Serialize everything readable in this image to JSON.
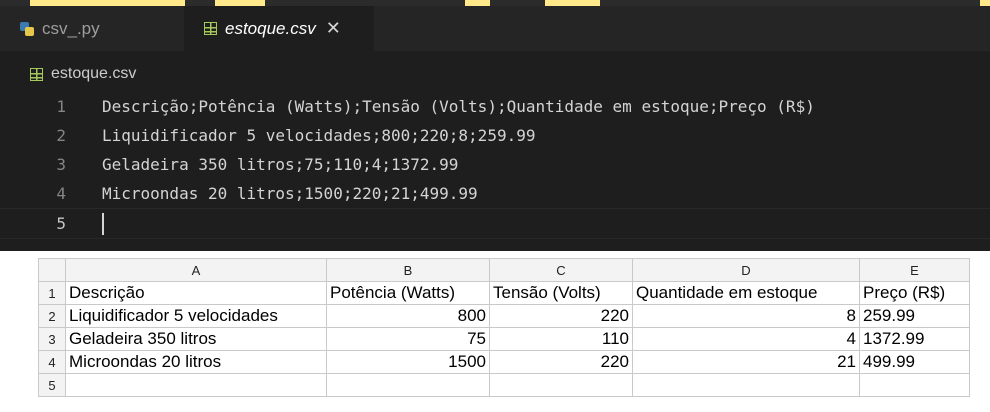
{
  "editor": {
    "tabs": [
      {
        "label": "csv_.py",
        "icon": "python-icon",
        "active": false
      },
      {
        "label": "estoque.csv",
        "icon": "csv-icon",
        "active": true,
        "close": "✕"
      }
    ],
    "breadcrumb": "estoque.csv",
    "lines": [
      {
        "num": "1",
        "text": "Descrição;Potência (Watts);Tensão (Volts);Quantidade em estoque;Preço (R$)"
      },
      {
        "num": "2",
        "text": "Liquidificador 5 velocidades;800;220;8;259.99"
      },
      {
        "num": "3",
        "text": "Geladeira 350 litros;75;110;4;1372.99"
      },
      {
        "num": "4",
        "text": "Microondas 20 litros;1500;220;21;499.99"
      },
      {
        "num": "5",
        "text": ""
      }
    ]
  },
  "spreadsheet": {
    "columns": [
      "A",
      "B",
      "C",
      "D",
      "E"
    ],
    "rows": [
      {
        "num": "1",
        "cells": [
          "Descrição",
          "Potência (Watts)",
          "Tensão (Volts)",
          "Quantidade em estoque",
          "Preço (R$)"
        ]
      },
      {
        "num": "2",
        "cells": [
          "Liquidificador 5 velocidades",
          "800",
          "220",
          "8",
          "259.99"
        ]
      },
      {
        "num": "3",
        "cells": [
          "Geladeira 350 litros",
          "75",
          "110",
          "4",
          "1372.99"
        ]
      },
      {
        "num": "4",
        "cells": [
          "Microondas 20 litros",
          "1500",
          "220",
          "21",
          "499.99"
        ]
      },
      {
        "num": "5",
        "cells": [
          "",
          "",
          "",
          "",
          ""
        ]
      }
    ]
  }
}
